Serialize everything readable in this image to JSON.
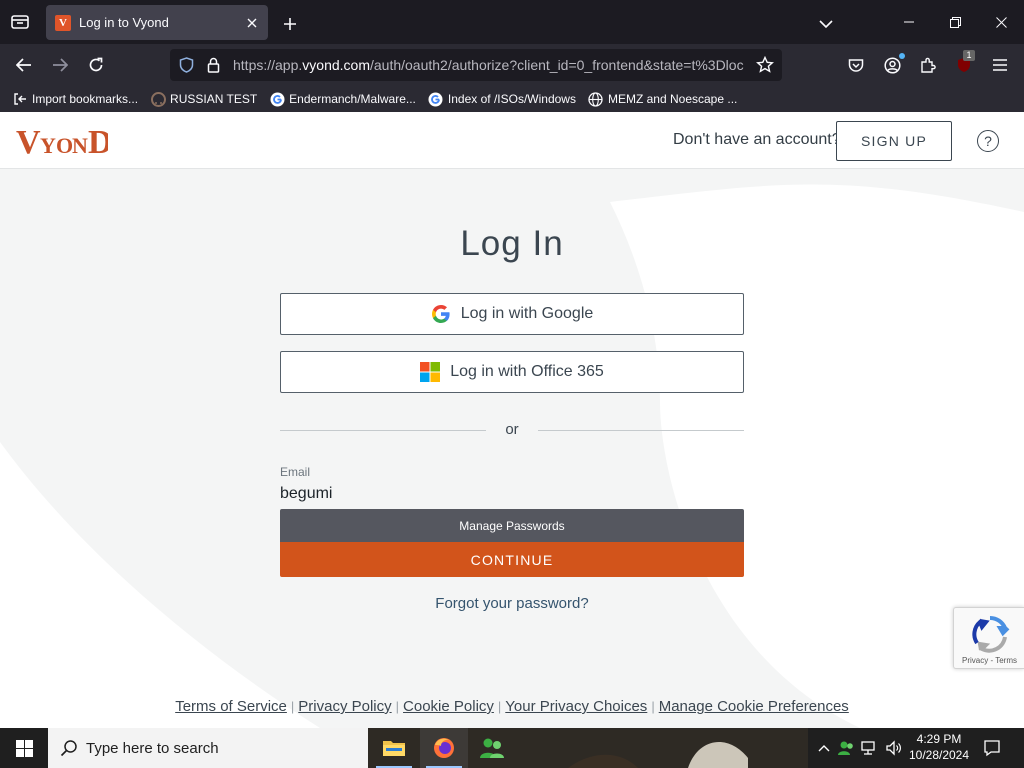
{
  "browser": {
    "tab": {
      "title": "Log in to Vyond",
      "favicon_letter": "V"
    },
    "url": {
      "prefix": "https://app.",
      "domain": "vyond.com",
      "path": "/auth/oauth2/authorize?client_id=0_frontend&state=t%3Dloc"
    },
    "extension_badge": "1",
    "bookmarks": [
      {
        "label": "Import bookmarks...",
        "icon": "import-icon"
      },
      {
        "label": "RUSSIAN TEST",
        "icon": "github-icon"
      },
      {
        "label": "Endermanch/Malware...",
        "icon": "google-icon"
      },
      {
        "label": "Index of /ISOs/Windows",
        "icon": "google-icon"
      },
      {
        "label": "MEMZ and Noescape ...",
        "icon": "globe-icon"
      }
    ]
  },
  "header": {
    "logo_text": "VYOND",
    "no_account_text": "Don't have an account?",
    "signup_label": "SIGN UP",
    "help_label": "?"
  },
  "login": {
    "title": "Log In",
    "google_label": "Log in with Google",
    "office_label": "Log in with Office 365",
    "or_text": "or",
    "email_label": "Email",
    "email_value": "begumi",
    "manage_passwords_label": "Manage Passwords",
    "continue_label": "CONTINUE",
    "forgot_label": "Forgot your password?"
  },
  "recaptcha": {
    "text": "Privacy - Terms"
  },
  "footer": {
    "links": [
      "Terms of Service",
      "Privacy Policy",
      "Cookie Policy",
      "Your Privacy Choices",
      "Manage Cookie Preferences"
    ],
    "separator": "|"
  },
  "taskbar": {
    "search_placeholder": "Type here to search",
    "time": "4:29 PM",
    "date": "10/28/2024"
  },
  "colors": {
    "accent": "#d2541b",
    "logo": "#c8532a",
    "manage_passwords_bg": "#55575f",
    "link": "#35546e"
  }
}
